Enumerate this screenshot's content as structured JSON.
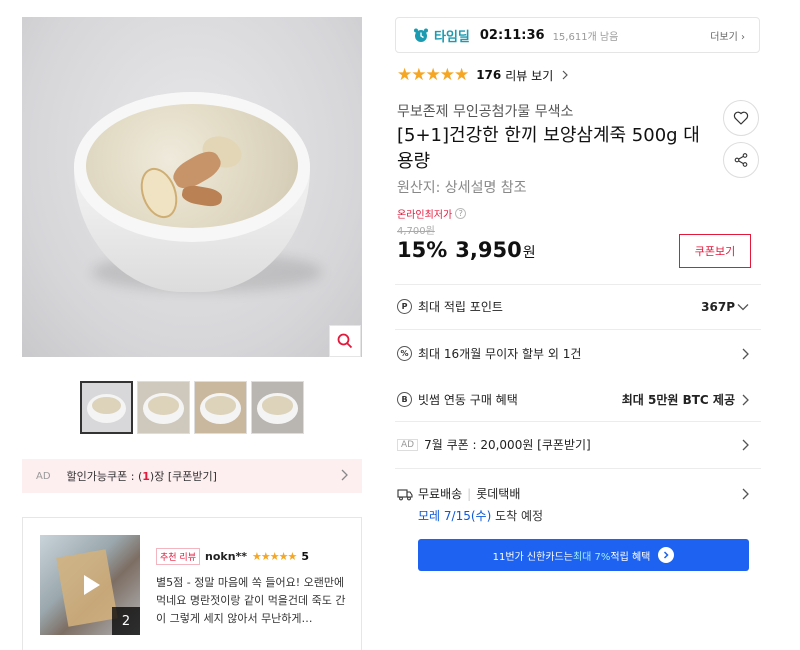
{
  "gallery": {
    "thumbnail_count": 4
  },
  "coupon_banner": {
    "ad_label": "AD",
    "prefix": "할인가능쿠폰 : (",
    "count": "1",
    "suffix": ")장 [쿠폰받기]"
  },
  "review": {
    "badge": "추천 리뷰",
    "user": "nokn**",
    "stars": "★★★★★",
    "score": "5",
    "text": "별5점 - 정말 마음에 쏙 들어요! 오랜만에 먹네요 명란젓이랑 같이 먹을건데 죽도 간이 그렇게 세지 않아서 무난하게…",
    "image_count": "2"
  },
  "timedeal": {
    "label": "타임딜",
    "time": "02:11:36",
    "remaining": "15,611개 남음",
    "more": "더보기"
  },
  "rating": {
    "stars": "★★★★★",
    "value": 4.5,
    "review_count": "176",
    "review_link": "리뷰 보기"
  },
  "product": {
    "seller": "무보존제 무인공첨가물 무색소",
    "title": "[5+1]건강한 한끼 보양삼계죽 500g 대용량",
    "origin": "원산지:  상세설명 참조"
  },
  "price": {
    "lowest_label": "온라인최저가",
    "original": "4,700원",
    "discount": "15%",
    "final": "3,950",
    "unit": "원",
    "coupon_button": "쿠폰보기"
  },
  "info_rows": {
    "points_label": "최대 적립 포인트",
    "points_value": "367P",
    "installment_label": "최대 16개월 무이자 할부 외 1건",
    "btc_label": "빗썸 연동 구매 혜택",
    "btc_value": "최대 5만원 BTC 제공",
    "july_ad": "AD",
    "july_label": "7월 쿠폰 : 20,000원 [쿠폰받기]",
    "shipping_label": "무료배송",
    "shipping_carrier": "롯데택배",
    "ship_date_highlight": "모레 7/15(수)",
    "ship_date_suffix": " 도착 예정"
  },
  "card_banner": {
    "prefix": "11번가 신한카드는 ",
    "highlight": "최대 7%",
    "suffix": " 적립 혜택"
  },
  "colors": {
    "accent_red": "#e3193c",
    "accent_teal": "#1b9bb1",
    "banner_blue": "#1d62f0",
    "star": "#f5a623"
  }
}
